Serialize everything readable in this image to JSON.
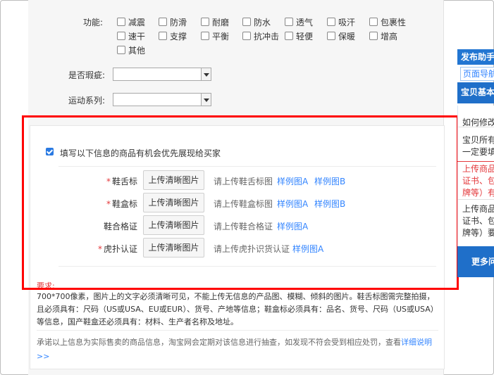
{
  "function_label": "功能:",
  "functions": [
    {
      "label": "减震"
    },
    {
      "label": "防滑"
    },
    {
      "label": "耐磨"
    },
    {
      "label": "防水"
    },
    {
      "label": "透气"
    },
    {
      "label": "吸汗"
    },
    {
      "label": "包裹性"
    },
    {
      "label": "速干"
    },
    {
      "label": "支撑"
    },
    {
      "label": "平衡"
    },
    {
      "label": "抗冲击"
    },
    {
      "label": "轻便"
    },
    {
      "label": "保暖"
    },
    {
      "label": "增高"
    },
    {
      "label": "其他"
    }
  ],
  "defect_label": "是否瑕疵:",
  "defect_value": "",
  "sport_series_label": "运动系列:",
  "sport_series_value": "",
  "priority_checkbox_label": "填写以下信息的商品有机会优先展现给买家",
  "upload_button_label": "上传清晰图片",
  "upload_rows": [
    {
      "required": "*",
      "label": "鞋舌标",
      "hint": "请上传鞋舌标图",
      "sample_a": "样例图A",
      "sample_b": "样例图B"
    },
    {
      "required": "*",
      "label": "鞋盒标",
      "hint": "请上传鞋盒标图",
      "sample_a": "样例图A",
      "sample_b": "样例图B"
    },
    {
      "required": "",
      "label": "鞋合格证",
      "hint": "请上传鞋合格证",
      "sample_a": "样例图A",
      "sample_b": ""
    },
    {
      "required": "*",
      "label": "虎扑认证",
      "hint": "请上传虎扑识货认证",
      "sample_a": "样例图A",
      "sample_b": ""
    }
  ],
  "requirements_title": "要求:",
  "requirements_text": "700*700像素，图片上的文字必须清晰可见，不能上传无信息的产品图、模糊、倾斜的图片。鞋舌标图需完整拍摄，且必须具有：尺码（US或USA、EU或EUR）、货号、产地等信息；鞋盒标必须具有：品名、货号、尺码（US或USA）等信息，国产鞋盒还必须具有：材料、生产者名称及地址。",
  "commitment_text": "承诺以上信息为实际售卖的商品信息，淘宝网会定期对该信息进行抽查，如发现不符会受到相应处罚，查看",
  "commitment_link": "详细说明",
  "commitment_arrow": ">>",
  "sidebar": {
    "helper_title": "发布助手",
    "page_nav": "页面导航",
    "basic_title": "宝贝基本信",
    "lines": [
      {
        "text": "如何修改",
        "color": "#333333"
      },
      {
        "text": "宝贝所有",
        "color": "#333333"
      },
      {
        "text": "一定要填",
        "color": "#333333"
      },
      {
        "text": "上传商品",
        "color": "#e4393c"
      },
      {
        "text": "证书、包",
        "color": "#e4393c"
      },
      {
        "text": "牌等）有",
        "color": "#e4393c"
      },
      {
        "text": "上传商品",
        "color": "#333333"
      },
      {
        "text": "证书、包",
        "color": "#333333"
      },
      {
        "text": "牌等）要",
        "color": "#333333"
      }
    ],
    "more": "更多问"
  },
  "colors": {
    "accent": "#3385ff",
    "required": "#e4393c",
    "highlight": "#ff0000",
    "sidebar_blue": "#2276d2"
  }
}
